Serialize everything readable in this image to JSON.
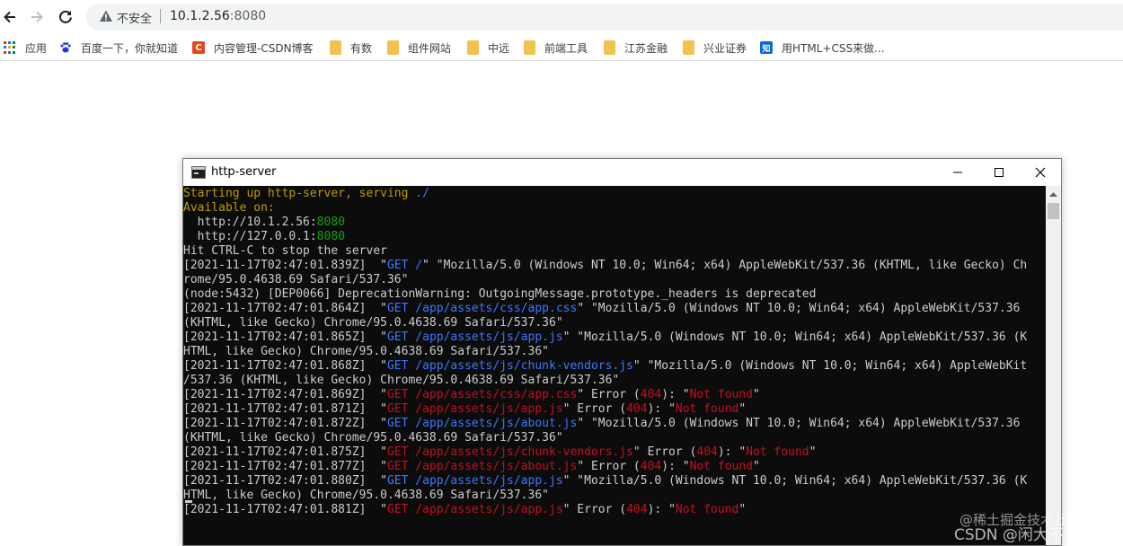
{
  "browser": {
    "insecure_label": "不安全",
    "url_host": "10.1.2.56",
    "url_port": ":8080",
    "bookmarks": [
      {
        "label": "应用",
        "icon": "apps-grid-icon"
      },
      {
        "label": "百度一下，你就知道",
        "icon": "baidu-paw-icon"
      },
      {
        "label": "内容管理-CSDN博客",
        "icon": "csdn-icon"
      },
      {
        "label": "有数",
        "icon": "folder-icon"
      },
      {
        "label": "组件网站",
        "icon": "folder-icon"
      },
      {
        "label": "中远",
        "icon": "folder-icon"
      },
      {
        "label": "前端工具",
        "icon": "folder-icon"
      },
      {
        "label": "江苏金融",
        "icon": "folder-icon"
      },
      {
        "label": "兴业证券",
        "icon": "folder-icon"
      },
      {
        "label": "用HTML+CSS来做...",
        "icon": "zhihu-icon"
      }
    ],
    "csdn_icon_text": "C",
    "zhihu_icon_text": "知"
  },
  "console": {
    "title": "http-server",
    "lines": [
      [
        {
          "t": "Starting up http-server, serving ",
          "c": "c-yellow"
        },
        {
          "t": "./",
          "c": "c-blue"
        }
      ],
      [
        {
          "t": "Available on:",
          "c": "c-yellow"
        }
      ],
      [
        {
          "t": "  http://10.1.2.56:",
          "c": ""
        },
        {
          "t": "8080",
          "c": "c-green"
        }
      ],
      [
        {
          "t": "  http://127.0.0.1:",
          "c": ""
        },
        {
          "t": "8080",
          "c": "c-green"
        }
      ],
      [
        {
          "t": "Hit CTRL-C to stop the server",
          "c": ""
        }
      ],
      [
        {
          "t": "[2021-11-17T02:47:01.839Z]  \"",
          "c": ""
        },
        {
          "t": "GET /",
          "c": "c-blue"
        },
        {
          "t": "\" \"Mozilla/5.0 (Windows NT 10.0; Win64; x64) AppleWebKit/537.36 (KHTML, like Gecko) Ch",
          "c": ""
        }
      ],
      [
        {
          "t": "rome/95.0.4638.69 Safari/537.36\"",
          "c": ""
        }
      ],
      [
        {
          "t": "(node:5432) [DEP0066] DeprecationWarning: OutgoingMessage.prototype._headers is deprecated",
          "c": ""
        }
      ],
      [
        {
          "t": "[2021-11-17T02:47:01.864Z]  \"",
          "c": ""
        },
        {
          "t": "GET /app/assets/css/app.css",
          "c": "c-blue"
        },
        {
          "t": "\" \"Mozilla/5.0 (Windows NT 10.0; Win64; x64) AppleWebKit/537.36",
          "c": ""
        }
      ],
      [
        {
          "t": "(KHTML, like Gecko) Chrome/95.0.4638.69 Safari/537.36\"",
          "c": ""
        }
      ],
      [
        {
          "t": "[2021-11-17T02:47:01.865Z]  \"",
          "c": ""
        },
        {
          "t": "GET /app/assets/js/app.js",
          "c": "c-blue"
        },
        {
          "t": "\" \"Mozilla/5.0 (Windows NT 10.0; Win64; x64) AppleWebKit/537.36 (K",
          "c": ""
        }
      ],
      [
        {
          "t": "HTML, like Gecko) Chrome/95.0.4638.69 Safari/537.36\"",
          "c": ""
        }
      ],
      [
        {
          "t": "[2021-11-17T02:47:01.868Z]  \"",
          "c": ""
        },
        {
          "t": "GET /app/assets/js/chunk-vendors.js",
          "c": "c-blue"
        },
        {
          "t": "\" \"Mozilla/5.0 (Windows NT 10.0; Win64; x64) AppleWebKit",
          "c": ""
        }
      ],
      [
        {
          "t": "/537.36 (KHTML, like Gecko) Chrome/95.0.4638.69 Safari/537.36\"",
          "c": ""
        }
      ],
      [
        {
          "t": "[2021-11-17T02:47:01.869Z]  \"",
          "c": ""
        },
        {
          "t": "GET /app/assets/css/app.css",
          "c": "c-red"
        },
        {
          "t": "\" Error (",
          "c": ""
        },
        {
          "t": "404",
          "c": "c-red"
        },
        {
          "t": "): \"",
          "c": ""
        },
        {
          "t": "Not found",
          "c": "c-red"
        },
        {
          "t": "\"",
          "c": ""
        }
      ],
      [
        {
          "t": "[2021-11-17T02:47:01.871Z]  \"",
          "c": ""
        },
        {
          "t": "GET /app/assets/js/app.js",
          "c": "c-red"
        },
        {
          "t": "\" Error (",
          "c": ""
        },
        {
          "t": "404",
          "c": "c-red"
        },
        {
          "t": "): \"",
          "c": ""
        },
        {
          "t": "Not found",
          "c": "c-red"
        },
        {
          "t": "\"",
          "c": ""
        }
      ],
      [
        {
          "t": "[2021-11-17T02:47:01.872Z]  \"",
          "c": ""
        },
        {
          "t": "GET /app/assets/js/about.js",
          "c": "c-blue"
        },
        {
          "t": "\" \"Mozilla/5.0 (Windows NT 10.0; Win64; x64) AppleWebKit/537.36",
          "c": ""
        }
      ],
      [
        {
          "t": "(KHTML, like Gecko) Chrome/95.0.4638.69 Safari/537.36\"",
          "c": ""
        }
      ],
      [
        {
          "t": "[2021-11-17T02:47:01.875Z]  \"",
          "c": ""
        },
        {
          "t": "GET /app/assets/js/chunk-vendors.js",
          "c": "c-red"
        },
        {
          "t": "\" Error (",
          "c": ""
        },
        {
          "t": "404",
          "c": "c-red"
        },
        {
          "t": "): \"",
          "c": ""
        },
        {
          "t": "Not found",
          "c": "c-red"
        },
        {
          "t": "\"",
          "c": ""
        }
      ],
      [
        {
          "t": "[2021-11-17T02:47:01.877Z]  \"",
          "c": ""
        },
        {
          "t": "GET /app/assets/js/about.js",
          "c": "c-red"
        },
        {
          "t": "\" Error (",
          "c": ""
        },
        {
          "t": "404",
          "c": "c-red"
        },
        {
          "t": "): \"",
          "c": ""
        },
        {
          "t": "Not found",
          "c": "c-red"
        },
        {
          "t": "\"",
          "c": ""
        }
      ],
      [
        {
          "t": "[2021-11-17T02:47:01.880Z]  \"",
          "c": ""
        },
        {
          "t": "GET /app/assets/js/app.js",
          "c": "c-blue"
        },
        {
          "t": "\" \"Mozilla/5.0 (Windows NT 10.0; Win64; x64) AppleWebKit/537.36 (K",
          "c": ""
        }
      ],
      [
        {
          "t": "HTML, like Gecko) Chrome/95.0.4638.69 Safari/537.36\"",
          "c": ""
        }
      ],
      [
        {
          "t": "[2021-11-17T02:47:01.881Z]  \"",
          "c": ""
        },
        {
          "t": "GET /app/assets/js/app.js",
          "c": "c-red"
        },
        {
          "t": "\" Error (",
          "c": ""
        },
        {
          "t": "404",
          "c": "c-red"
        },
        {
          "t": "): \"",
          "c": ""
        },
        {
          "t": "Not found",
          "c": "c-red"
        },
        {
          "t": "\"",
          "c": ""
        }
      ]
    ]
  },
  "watermark": {
    "line1": "@稀土掘金技术社区",
    "line2": "CSDN @闲大不梦卿"
  },
  "colors": {
    "terminal_bg": "#0c0c0c",
    "terminal_fg": "#cccccc",
    "yellow": "#c19c00",
    "green": "#13a10e",
    "blue": "#3b78ff",
    "red": "#c50f1f"
  }
}
